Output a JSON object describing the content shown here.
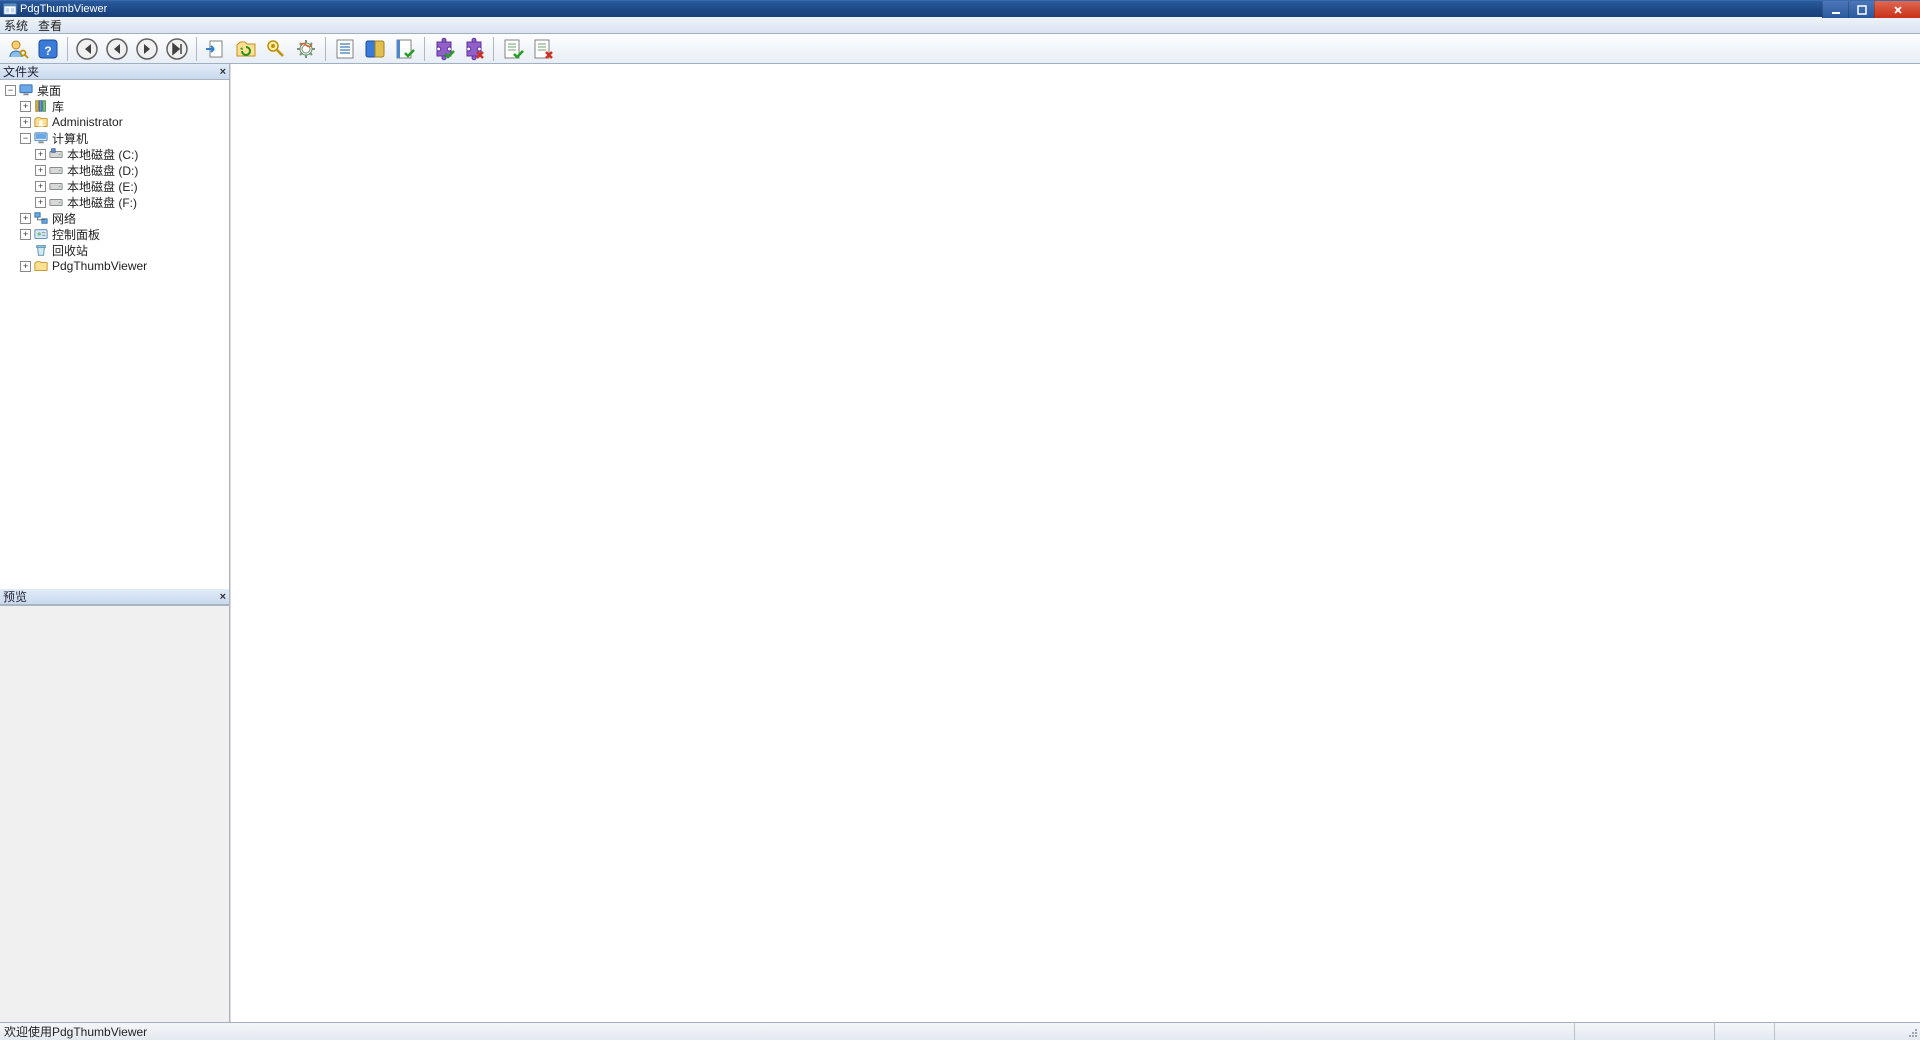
{
  "window": {
    "title": "PdgThumbViewer"
  },
  "menu": {
    "system": "系统",
    "view": "查看"
  },
  "toolbar_icons": [
    "user-key-icon",
    "help-icon",
    "nav-first-icon",
    "nav-prev-icon",
    "nav-next-icon",
    "nav-last-icon",
    "export-icon",
    "refresh-folder-icon",
    "find-key-icon",
    "settings-gear-icon",
    "list-view-icon",
    "book-blue-icon",
    "book-check-icon",
    "puzzle-check-icon",
    "puzzle-x-icon",
    "sheet-check-icon",
    "sheet-x-icon"
  ],
  "panels": {
    "folders_title": "文件夹",
    "preview_title": "预览"
  },
  "tree": {
    "root": {
      "label": "桌面",
      "expanded": true
    },
    "nodes": [
      {
        "label": "库",
        "icon": "library-icon",
        "indent": 1,
        "expandable": true
      },
      {
        "label": "Administrator",
        "icon": "user-folder-icon",
        "indent": 1,
        "expandable": true
      },
      {
        "label": "计算机",
        "icon": "computer-icon",
        "indent": 1,
        "expandable": true,
        "expanded": true,
        "children": [
          {
            "label": "本地磁盘 (C:)",
            "icon": "drive-system-icon",
            "indent": 2,
            "expandable": true
          },
          {
            "label": "本地磁盘 (D:)",
            "icon": "drive-icon",
            "indent": 2,
            "expandable": true
          },
          {
            "label": "本地磁盘 (E:)",
            "icon": "drive-icon",
            "indent": 2,
            "expandable": true
          },
          {
            "label": "本地磁盘 (F:)",
            "icon": "drive-icon",
            "indent": 2,
            "expandable": true
          }
        ]
      },
      {
        "label": "网络",
        "icon": "network-icon",
        "indent": 1,
        "expandable": true
      },
      {
        "label": "控制面板",
        "icon": "control-panel-icon",
        "indent": 1,
        "expandable": true
      },
      {
        "label": "回收站",
        "icon": "recycle-bin-icon",
        "indent": 1,
        "expandable": false
      },
      {
        "label": "PdgThumbViewer",
        "icon": "folder-icon",
        "indent": 1,
        "expandable": true
      }
    ]
  },
  "statusbar": {
    "message": "欢迎使用PdgThumbViewer"
  }
}
